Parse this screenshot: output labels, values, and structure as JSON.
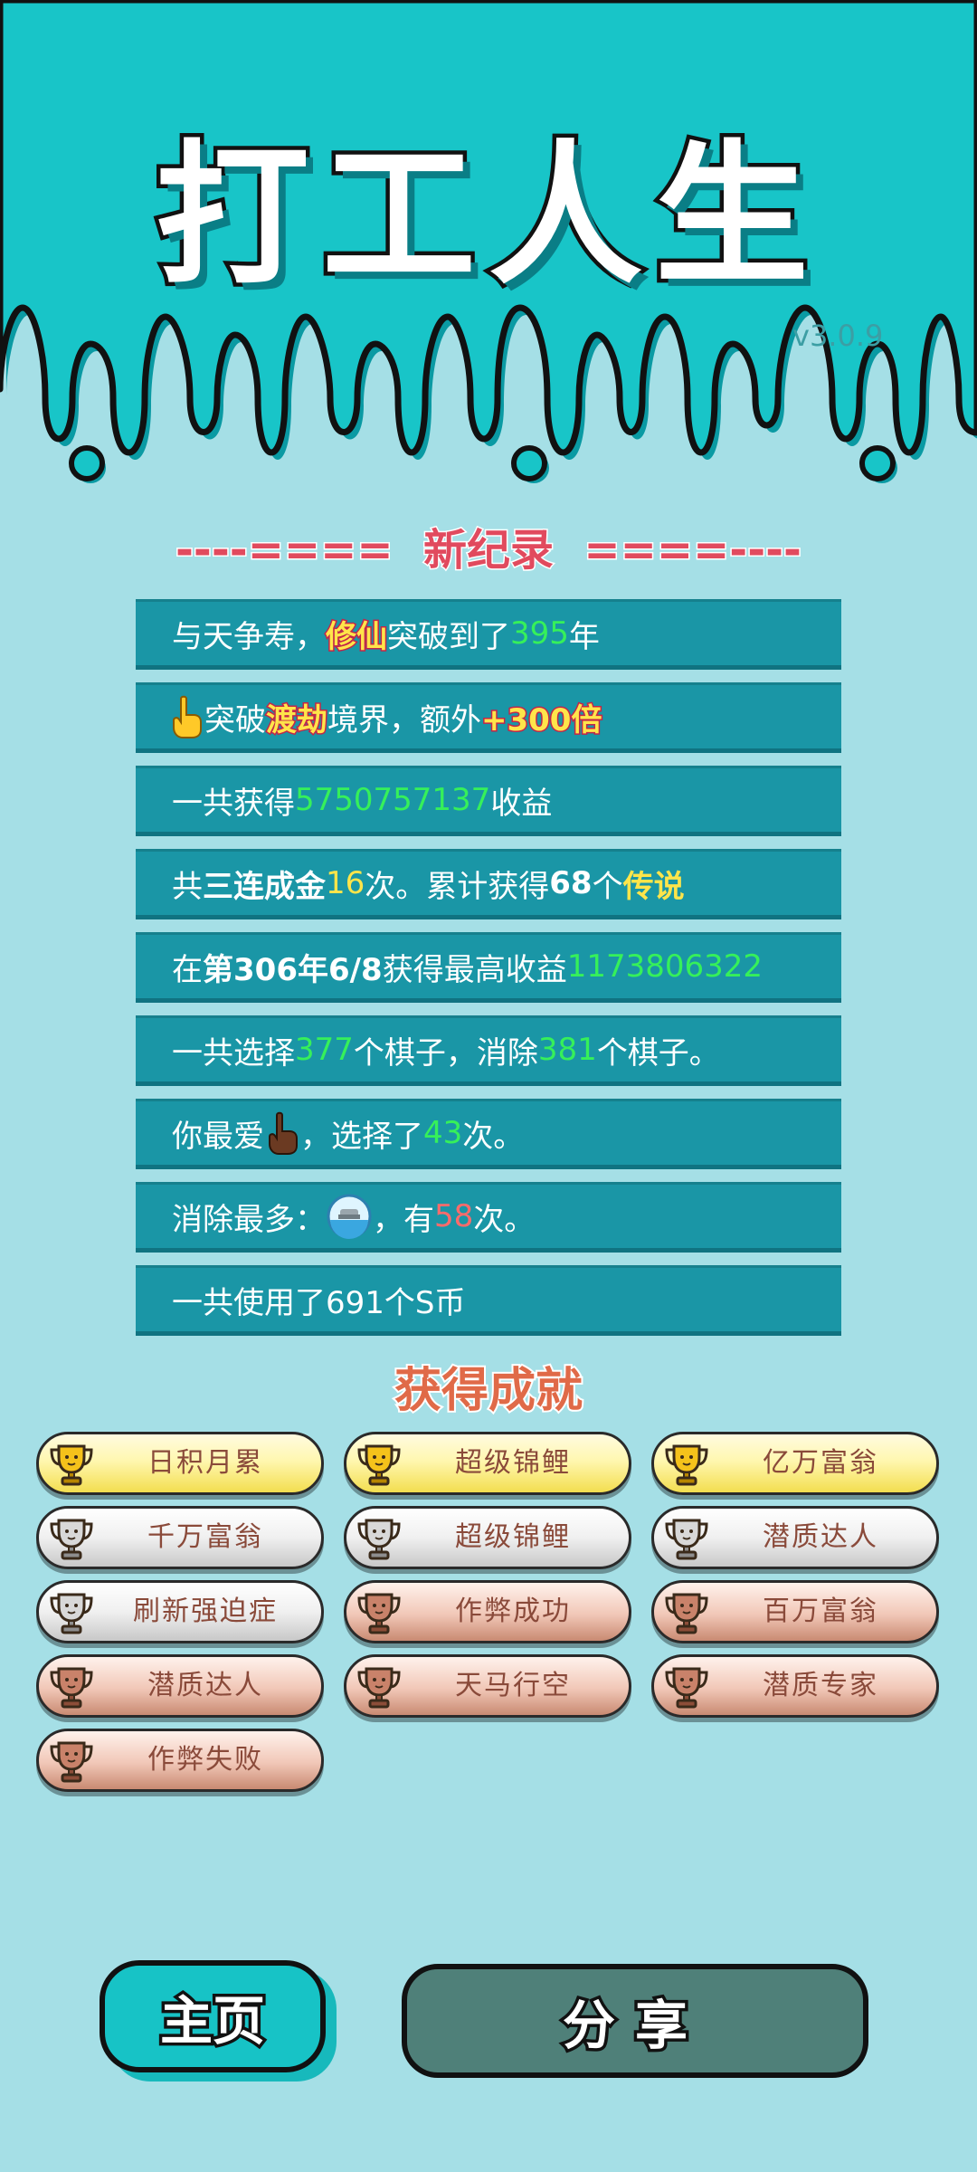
{
  "app": {
    "title": "打工人生",
    "version": "v3.0.9",
    "colors": {
      "header": "#17c3c6",
      "background": "#a5dfe6",
      "stat_bar": "#1a96a6",
      "highlight_green": "#36f05a",
      "highlight_yellow": "#ffe54a"
    }
  },
  "record": {
    "heading": "----====  新纪录  ====----",
    "rows": [
      {
        "t1": "与天争寿，",
        "tag": "修仙",
        "t2": "突破到了",
        "num": "395",
        "t3": "年"
      },
      {
        "icon": "pointing-hand-icon",
        "t1": "突破",
        "tag": "渡劫",
        "t2": "境界，额外",
        "tag2": "+300倍"
      },
      {
        "t1": "一共获得",
        "num": "5750757137",
        "t2": "收益"
      },
      {
        "t1": "共",
        "bold": "三连成金",
        "num": "16",
        "t2": "次。累计获得",
        "bold2": "68",
        "t3": "个",
        "tag": "传说"
      },
      {
        "t1": "在 ",
        "bold": "第306年6/8",
        "t2": " 获得最高收益",
        "num": "1173806322"
      },
      {
        "t1": "一共选择",
        "num": "377",
        "t2": "个棋子，消除",
        "num2": "381",
        "t3": "个棋子。"
      },
      {
        "t1": "你最爱",
        "icon": "pointing-up-hand-icon",
        "t2": "，选择了",
        "num": "43",
        "t3": "次。"
      },
      {
        "t1": "消除最多：",
        "icon": "snow-globe-icon",
        "t2": "，有",
        "num": "58",
        "t3": "次。"
      },
      {
        "t1": "一共使用了691个S币"
      }
    ]
  },
  "achievements": {
    "title": "获得成就",
    "items": [
      {
        "label": "日积月累",
        "tier": "gold"
      },
      {
        "label": "超级锦鲤",
        "tier": "gold"
      },
      {
        "label": "亿万富翁",
        "tier": "gold"
      },
      {
        "label": "千万富翁",
        "tier": "silver"
      },
      {
        "label": "超级锦鲤",
        "tier": "silver"
      },
      {
        "label": "潜质达人",
        "tier": "silver"
      },
      {
        "label": "刷新强迫症",
        "tier": "silver"
      },
      {
        "label": "作弊成功",
        "tier": "bronze"
      },
      {
        "label": "百万富翁",
        "tier": "bronze"
      },
      {
        "label": "潜质达人",
        "tier": "bronze"
      },
      {
        "label": "天马行空",
        "tier": "bronze"
      },
      {
        "label": "潜质专家",
        "tier": "bronze"
      },
      {
        "label": "作弊失败",
        "tier": "bronze"
      }
    ]
  },
  "buttons": {
    "home": "主页",
    "share": "分享"
  }
}
